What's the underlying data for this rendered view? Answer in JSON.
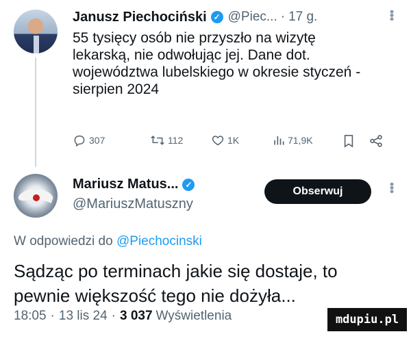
{
  "parent_tweet": {
    "author_name": "Janusz Piechociński",
    "handle": "@Piec...",
    "dot": "·",
    "time": "17 g.",
    "text": "55 tysięcy osób nie przyszło na wizytę lekarską, nie odwołując jej. Dane dot. województwa lubelskiego w okresie styczeń -sierpien 2024",
    "actions": {
      "replies": "307",
      "reposts": "112",
      "likes": "1K",
      "views": "71,9K"
    }
  },
  "reply_tweet": {
    "author_name": "Mariusz Matus...",
    "handle": "@MariuszMatuszny",
    "follow_label": "Obserwuj",
    "reply_to_prefix": "W odpowiedzi do",
    "reply_to_handle": "@Piechocinski",
    "text": "Sądząc po terminach jakie się dostaje, to pewnie większość tego nie dożyła...",
    "time": "18:05",
    "date": "13 lis 24",
    "views_count": "3 037",
    "views_label": "Wyświetlenia"
  },
  "watermark": "mdupiu.pl",
  "icons": {
    "verified": "verified-badge-icon",
    "reply": "reply-icon",
    "repost": "repost-icon",
    "like": "like-icon",
    "views": "views-icon",
    "bookmark": "bookmark-icon",
    "share": "share-icon",
    "more": "more-icon"
  },
  "colors": {
    "accent": "#1d9bf0",
    "secondary_text": "#536471",
    "button_bg": "#0f1419"
  }
}
